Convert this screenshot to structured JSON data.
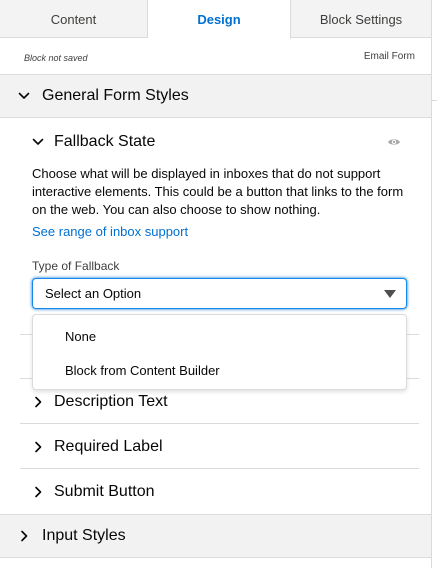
{
  "tabs": [
    {
      "label": "Content"
    },
    {
      "label": "Design"
    },
    {
      "label": "Block Settings"
    }
  ],
  "status": {
    "left": "Block not saved",
    "right": "Email Form"
  },
  "general_form_styles": {
    "label": "General Form Styles",
    "fallback_state": {
      "label": "Fallback State",
      "visibility_icon": "eye-icon",
      "description": "Choose what will be displayed in inboxes that do not support interactive elements. This could be a button that links to the form on the web. You can also choose to show nothing.",
      "link": "See range of inbox support",
      "field_label": "Type of Fallback",
      "select_placeholder": "Select an Option",
      "options": [
        "None",
        "Block from Content Builder"
      ]
    },
    "subsections": [
      {
        "label": "Description Text"
      },
      {
        "label": "Required Label"
      },
      {
        "label": "Submit Button"
      }
    ]
  },
  "input_styles": {
    "label": "Input Styles"
  },
  "colors": {
    "accent": "#0070d2",
    "border": "#dddbda",
    "header_bg": "#f3f2f2",
    "text": "#080707"
  }
}
